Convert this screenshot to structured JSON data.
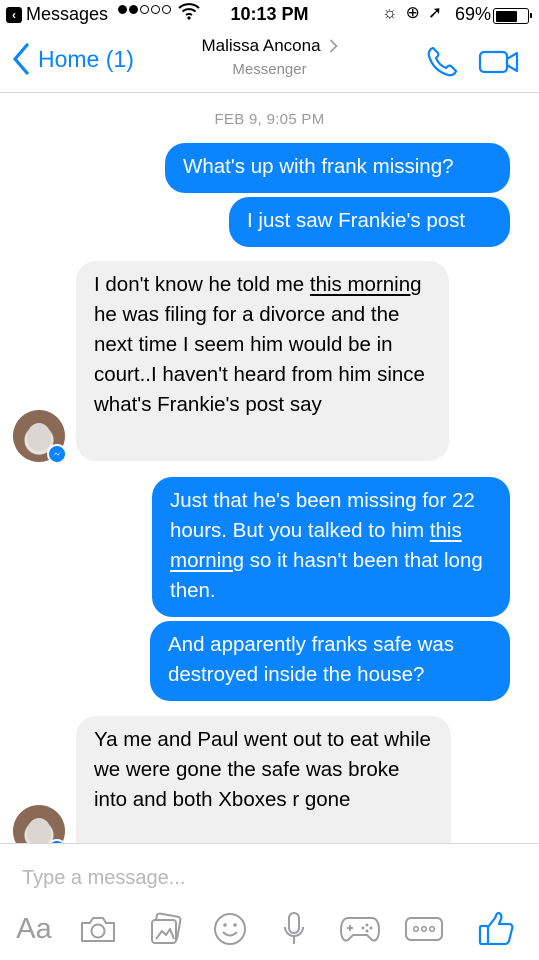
{
  "status_bar": {
    "back_app": "Messages",
    "time": "10:13 PM",
    "battery": "69%",
    "battery_level": 0.69,
    "signal_bars": 2
  },
  "header": {
    "back_label": "Home (1)",
    "contact_name": "Malissa Ancona",
    "subtitle": "Messenger",
    "icons": [
      "chevron-left-icon",
      "chevron-right-icon",
      "phone-icon",
      "video-camera-icon"
    ]
  },
  "conversation": {
    "timestamp": "FEB 9, 9:05 PM",
    "messages": [
      {
        "side": "out",
        "lines": [
          "What's up with frank missing?"
        ]
      },
      {
        "side": "out",
        "lines": [
          "I just saw Frankie's post"
        ]
      },
      {
        "side": "in",
        "segments": [
          "I don't know he told me ",
          "this morning",
          " he was filing for a divorce and the next time I seem him would be in court..I haven't heard from him since what's Frankie's post say"
        ]
      },
      {
        "side": "out",
        "segments": [
          "Just that he's been missing for 22 hours. But you talked to him ",
          "this morning",
          " so it hasn't been that long then."
        ]
      },
      {
        "side": "out",
        "lines": [
          "And apparently franks safe was destroyed inside the house?"
        ]
      },
      {
        "side": "in",
        "lines": [
          "Ya me and Paul went out to eat while we were gone the safe was broke into and both Xboxes r gone"
        ]
      }
    ]
  },
  "composer": {
    "placeholder": "Type a message...",
    "aa_label": "Aa",
    "tools": [
      "camera-icon",
      "photo-gallery-icon",
      "emoji-icon",
      "microphone-icon",
      "game-controller-icon",
      "more-icon",
      "thumbs-up-icon"
    ]
  },
  "colors": {
    "accent": "#0a84ff",
    "incoming_bubble": "#f1f0f0",
    "timestamp": "#9a9a9f",
    "toolbar_icon": "#9d9da2"
  }
}
